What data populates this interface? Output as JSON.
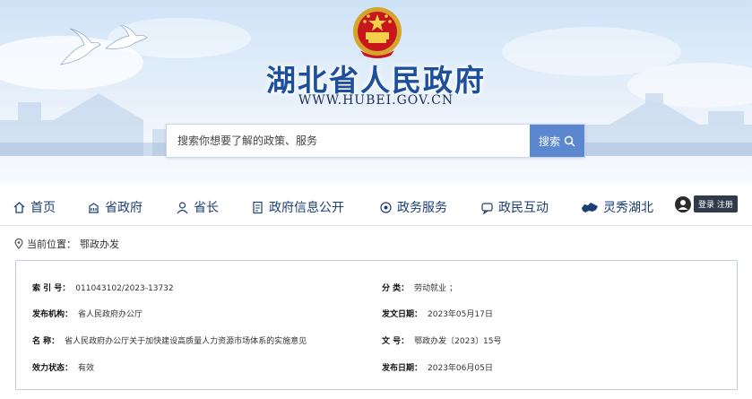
{
  "site": {
    "title": "湖北省人民政府",
    "url": "WWW.HUBEI.GOV.CN"
  },
  "search": {
    "placeholder": "搜索你想要了解的政策、服务",
    "button_label": "搜索"
  },
  "nav": {
    "items": [
      {
        "label": "首页",
        "icon": "home-icon"
      },
      {
        "label": "省政府",
        "icon": "building-icon"
      },
      {
        "label": "省长",
        "icon": "person-icon"
      },
      {
        "label": "政府信息公开",
        "icon": "document-icon"
      },
      {
        "label": "政务服务",
        "icon": "service-icon"
      },
      {
        "label": "政民互动",
        "icon": "chat-icon"
      },
      {
        "label": "灵秀湖北",
        "icon": "hubei-map-icon"
      }
    ],
    "login_label": "登录 注册"
  },
  "breadcrumb": {
    "label": "当前位置：",
    "current": "鄂政办发"
  },
  "info": {
    "index_label": "索 引 号：",
    "index_value": "011043102/2023-13732",
    "category_label": "分 类：",
    "category_value": "劳动就业 ；",
    "issuer_label": "发布机构：",
    "issuer_value": "省人民政府办公厅",
    "issue_date_label": "发文日期：",
    "issue_date_value": "2023年05月17日",
    "name_label": "名 称：",
    "name_value": "省人民政府办公厅关于加快建设高质量人力资源市场体系的实施意见",
    "doc_no_label": "文 号：",
    "doc_no_value": "鄂政办发〔2023〕15号",
    "status_label": "效力状态：",
    "status_value": "有效",
    "pub_date_label": "发布日期：",
    "pub_date_value": "2023年06月05日"
  },
  "colors": {
    "brand_blue": "#1c4f9c",
    "search_button": "#5a87d0",
    "nav_text": "#1c3f73"
  }
}
